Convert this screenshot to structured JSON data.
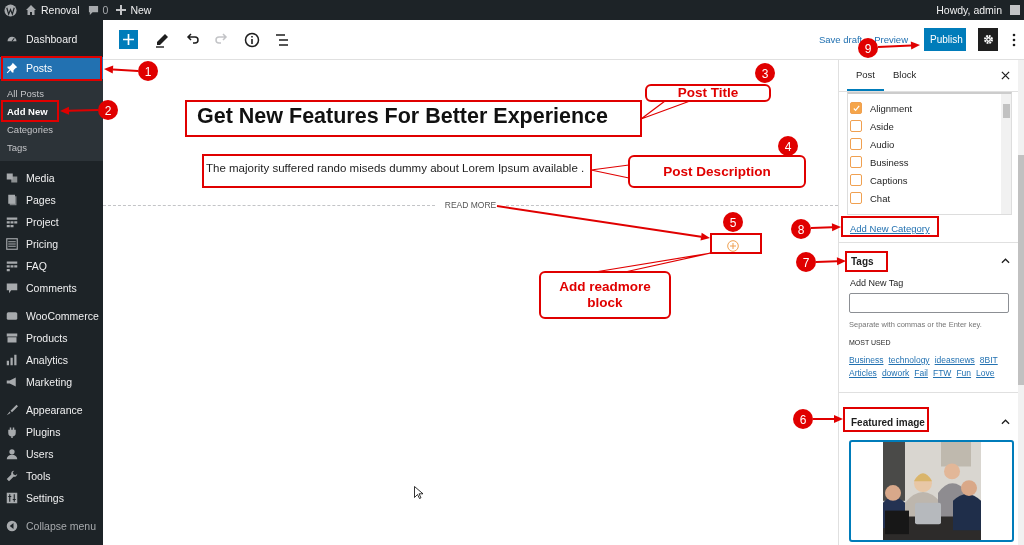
{
  "admin_bar": {
    "site_name": "Renoval",
    "comments_count": "0",
    "new_label": "New",
    "greeting": "Howdy, admin"
  },
  "sidebar": {
    "groups": [
      {
        "items": [
          {
            "label": "Dashboard",
            "selected": false
          },
          {
            "label": "Posts",
            "selected": true,
            "children": [
              {
                "label": "All Posts",
                "selected": false
              },
              {
                "label": "Add New",
                "selected": true
              },
              {
                "label": "Categories",
                "selected": false
              },
              {
                "label": "Tags",
                "selected": false
              }
            ]
          }
        ]
      },
      {
        "items": [
          {
            "label": "Media",
            "selected": false
          },
          {
            "label": "Pages",
            "selected": false
          },
          {
            "label": "Project",
            "selected": false
          },
          {
            "label": "Pricing",
            "selected": false
          },
          {
            "label": "FAQ",
            "selected": false
          },
          {
            "label": "Comments",
            "selected": false
          }
        ]
      },
      {
        "items": [
          {
            "label": "WooCommerce",
            "selected": false
          },
          {
            "label": "Products",
            "selected": false
          },
          {
            "label": "Analytics",
            "selected": false
          },
          {
            "label": "Marketing",
            "selected": false
          }
        ]
      },
      {
        "items": [
          {
            "label": "Appearance",
            "selected": false
          },
          {
            "label": "Plugins",
            "selected": false
          },
          {
            "label": "Users",
            "selected": false
          },
          {
            "label": "Tools",
            "selected": false
          },
          {
            "label": "Settings",
            "selected": false
          }
        ]
      }
    ],
    "collapse_label": "Collapse menu"
  },
  "toolbar": {
    "save_draft": "Save draft",
    "preview": "Preview",
    "publish": "Publish"
  },
  "editor": {
    "title": "Get New Features For Better Experience",
    "paragraph": "The majority suffered rando miseds dummy about Lorem Ipsum available .",
    "read_more": "READ MORE"
  },
  "settings_panel": {
    "tabs": [
      {
        "label": "Post",
        "selected": true
      },
      {
        "label": "Block",
        "selected": false
      }
    ],
    "categories": [
      {
        "label": "Alignment",
        "checked": true
      },
      {
        "label": "Aside",
        "checked": false
      },
      {
        "label": "Audio",
        "checked": false
      },
      {
        "label": "Business",
        "checked": false
      },
      {
        "label": "Captions",
        "checked": false
      },
      {
        "label": "Chat",
        "checked": false
      }
    ],
    "add_category": "Add New Category",
    "tags": {
      "title": "Tags",
      "expanded": true,
      "field_label": "Add New Tag",
      "help": "Separate with commas or the Enter key.",
      "most_used_label": "MOST USED",
      "most_used": [
        "Business",
        "technology",
        "ideasnews",
        "8BIT",
        "Articles",
        "dowork",
        "Fail",
        "FTW",
        "Fun",
        "Love"
      ]
    },
    "featured_image": {
      "title": "Featured image",
      "expanded": true
    }
  },
  "annotations": {
    "markers": [
      "1",
      "2",
      "3",
      "4",
      "5",
      "6",
      "7",
      "8",
      "9"
    ],
    "callouts": [
      "Post Title",
      "Post Description",
      "Add readmore block"
    ]
  }
}
